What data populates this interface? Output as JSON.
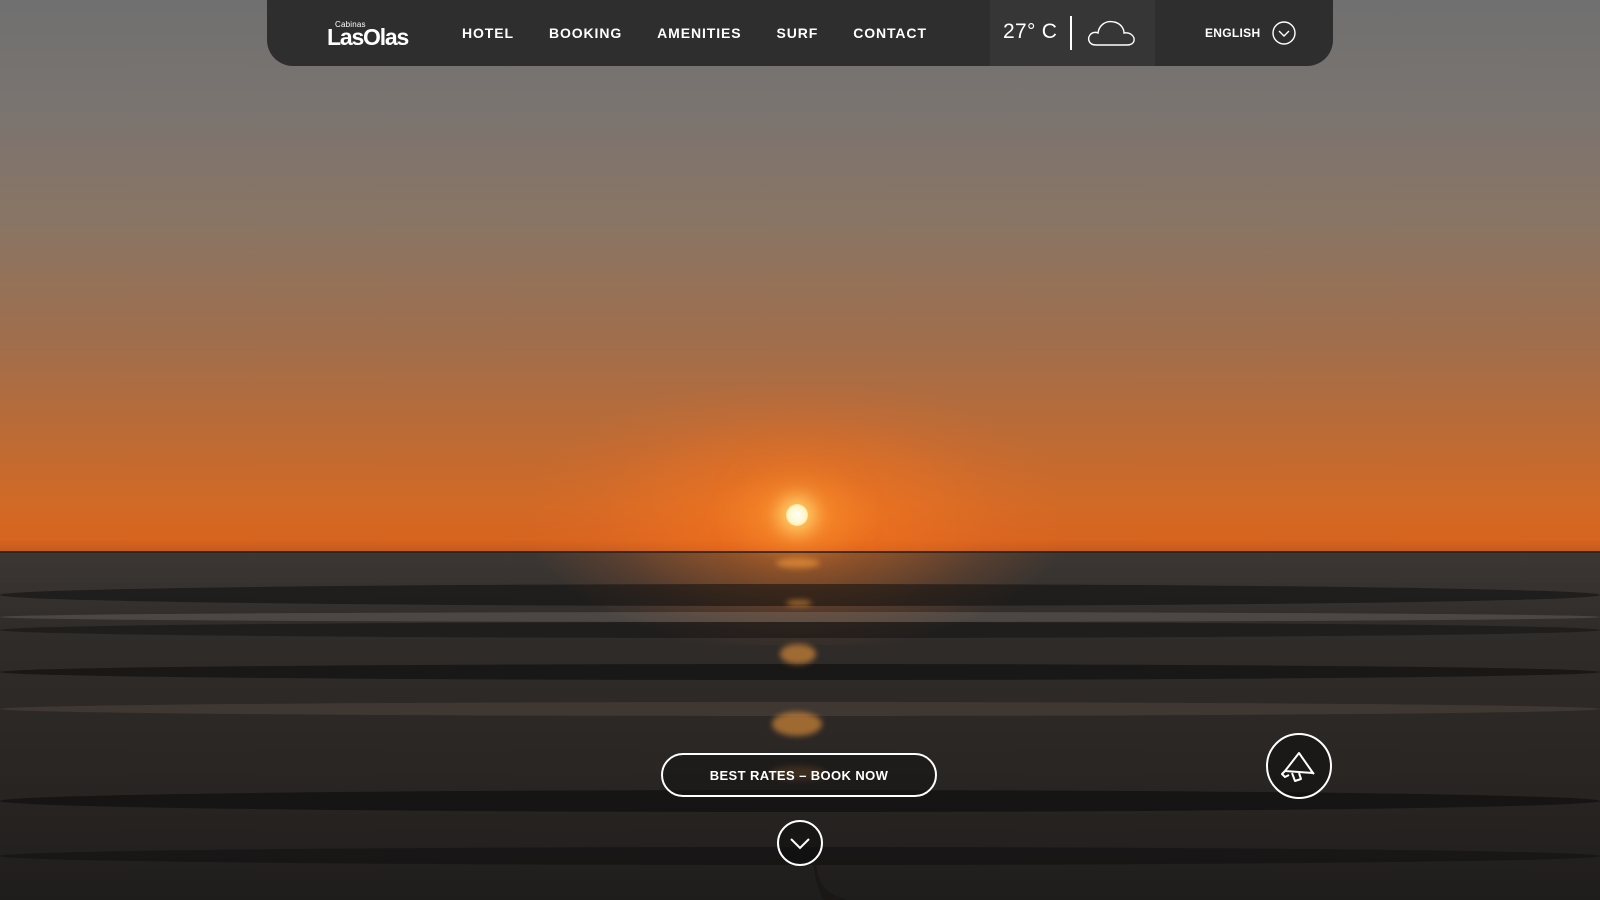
{
  "header": {
    "logo": {
      "small_text": "Cabinas",
      "brand_text": "LasOlas"
    },
    "nav": [
      {
        "label": "HOTEL"
      },
      {
        "label": "BOOKING"
      },
      {
        "label": "AMENITIES"
      },
      {
        "label": "SURF"
      },
      {
        "label": "CONTACT"
      }
    ],
    "weather": {
      "temperature": "27° C",
      "condition_icon": "cloud-icon"
    },
    "language": {
      "selected": "ENGLISH",
      "icon": "chevron-down-icon"
    }
  },
  "hero": {
    "cta_label": "BEST RATES – BOOK NOW",
    "scroll_icon": "chevron-down-icon",
    "promo_icon": "megaphone-icon"
  },
  "colors": {
    "navbar_bg": "#2e2e2e",
    "weather_bg": "#363636",
    "text": "#ffffff",
    "sunset_orange": "#d7641f"
  }
}
